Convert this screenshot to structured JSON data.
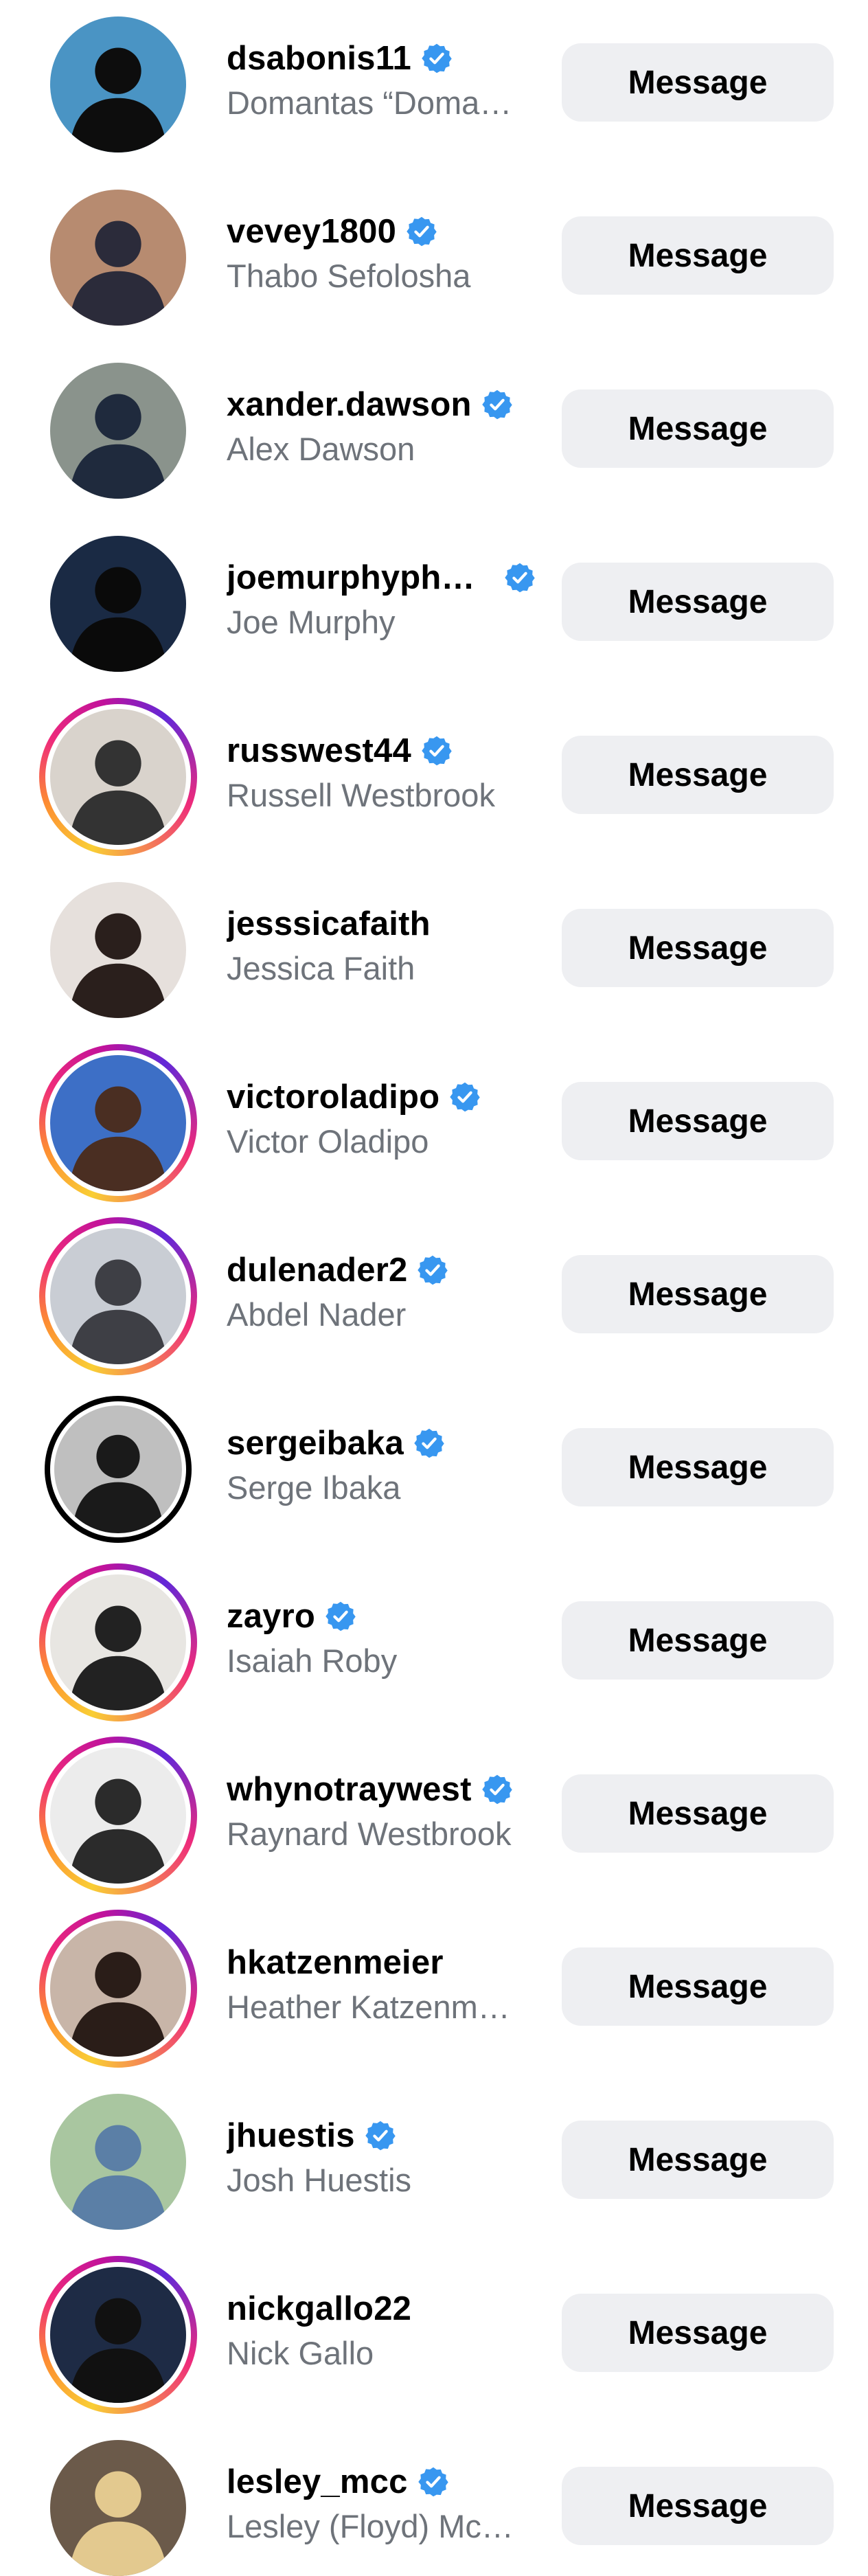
{
  "accounts": [
    {
      "username": "dsabonis11",
      "full_name": "Domantas “Doma…",
      "verified": true,
      "story_ring": "none",
      "avatar": {
        "bg": "#4a94c4",
        "fg": "#0d0d0d"
      }
    },
    {
      "username": "vevey1800",
      "full_name": "Thabo Sefolosha",
      "verified": true,
      "story_ring": "none",
      "avatar": {
        "bg": "#b78b70",
        "fg": "#2b2b3a"
      }
    },
    {
      "username": "xander.dawson",
      "full_name": "Alex Dawson",
      "verified": true,
      "story_ring": "none",
      "avatar": {
        "bg": "#8a938c",
        "fg": "#1f2a3d"
      }
    },
    {
      "username": "joemurphypho…",
      "full_name": "Joe Murphy",
      "verified": true,
      "story_ring": "none",
      "avatar": {
        "bg": "#1a2a44",
        "fg": "#0a0a0a"
      }
    },
    {
      "username": "russwest44",
      "full_name": "Russell Westbrook",
      "verified": true,
      "story_ring": "gradient",
      "avatar": {
        "bg": "#d9d3cc",
        "fg": "#333333"
      }
    },
    {
      "username": "jesssicafaith",
      "full_name": "Jessica Faith",
      "verified": false,
      "story_ring": "none",
      "avatar": {
        "bg": "#e6e0dc",
        "fg": "#2a1f1c"
      }
    },
    {
      "username": "victoroladipo",
      "full_name": "Victor Oladipo",
      "verified": true,
      "story_ring": "gradient",
      "avatar": {
        "bg": "#3d6fc6",
        "fg": "#4a2e22"
      }
    },
    {
      "username": "dulenader2",
      "full_name": "Abdel Nader",
      "verified": true,
      "story_ring": "gradient",
      "avatar": {
        "bg": "#c9cdd4",
        "fg": "#3e3f45"
      }
    },
    {
      "username": "sergeibaka",
      "full_name": "Serge Ibaka",
      "verified": true,
      "story_ring": "black",
      "avatar": {
        "bg": "#bfbfbf",
        "fg": "#1a1a1a"
      }
    },
    {
      "username": "zayro",
      "full_name": "Isaiah Roby",
      "verified": true,
      "story_ring": "gradient",
      "avatar": {
        "bg": "#e8e6e2",
        "fg": "#222222"
      }
    },
    {
      "username": "whynotraywest",
      "full_name": "Raynard Westbrook",
      "verified": true,
      "story_ring": "gradient",
      "avatar": {
        "bg": "#ececec",
        "fg": "#2b2b2b"
      }
    },
    {
      "username": "hkatzenmeier",
      "full_name": "Heather Katzenm…",
      "verified": false,
      "story_ring": "gradient",
      "avatar": {
        "bg": "#c8b5a8",
        "fg": "#2a1d18"
      }
    },
    {
      "username": "jhuestis",
      "full_name": "Josh Huestis",
      "verified": true,
      "story_ring": "none",
      "avatar": {
        "bg": "#a9c6a0",
        "fg": "#5b7fa6"
      }
    },
    {
      "username": "nickgallo22",
      "full_name": "Nick Gallo",
      "verified": false,
      "story_ring": "gradient",
      "avatar": {
        "bg": "#1e2b45",
        "fg": "#111111"
      }
    },
    {
      "username": "lesley_mcc",
      "full_name": "Lesley (Floyd) Mc…",
      "verified": true,
      "story_ring": "none",
      "avatar": {
        "bg": "#6b5a4a",
        "fg": "#e3c98f"
      }
    }
  ],
  "button_label": "Message",
  "colors": {
    "verified_badge": "#3897f0",
    "button_bg": "#eeeff2",
    "secondary_text": "#6e737a"
  },
  "icons": {
    "verified": "verified-badge-icon"
  }
}
